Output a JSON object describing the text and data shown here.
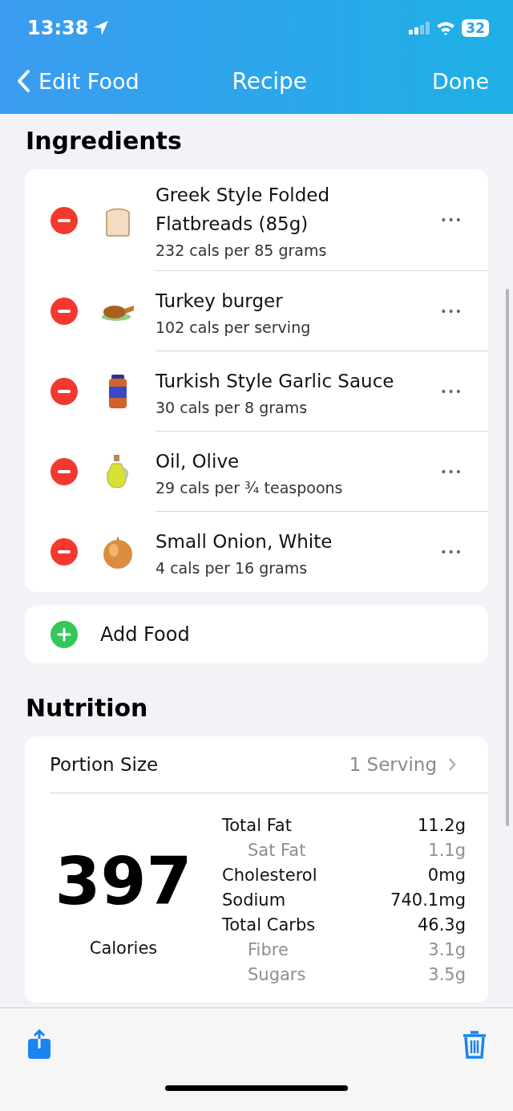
{
  "status_bar": {
    "time": "13:38",
    "battery": "32"
  },
  "nav": {
    "back": "Edit Food",
    "title": "Recipe",
    "action": "Done"
  },
  "ingredients": {
    "title": "Ingredients",
    "items": [
      {
        "name": "Greek Style Folded Flatbreads (85g)",
        "detail": "232 cals per 85 grams",
        "more": "•••"
      },
      {
        "name": "Turkey burger",
        "detail": "102 cals per serving",
        "more": "•••"
      },
      {
        "name": "Turkish Style Garlic Sauce",
        "detail": "30 cals per 8 grams",
        "more": "•••"
      },
      {
        "name": "Oil, Olive",
        "detail": "29 cals per ¾ teaspoons",
        "more": "•••"
      },
      {
        "name": "Small Onion, White",
        "detail": "4 cals per 16 grams",
        "more": "•••"
      }
    ],
    "add_label": "Add Food"
  },
  "nutrition": {
    "title": "Nutrition",
    "portion_label": "Portion Size",
    "portion_value": "1 Serving",
    "calories": "397",
    "calories_label": "Calories",
    "rows": [
      {
        "kind": "main",
        "label": "Total Fat",
        "value": "11.2g"
      },
      {
        "kind": "sub",
        "label": "Sat Fat",
        "value": "1.1g"
      },
      {
        "kind": "main",
        "label": "Cholesterol",
        "value": "0mg"
      },
      {
        "kind": "main",
        "label": "Sodium",
        "value": "740.1mg"
      },
      {
        "kind": "main",
        "label": "Total Carbs",
        "value": "46.3g"
      },
      {
        "kind": "sub",
        "label": "Fibre",
        "value": "3.1g"
      },
      {
        "kind": "sub",
        "label": "Sugars",
        "value": "3.5g"
      }
    ]
  }
}
